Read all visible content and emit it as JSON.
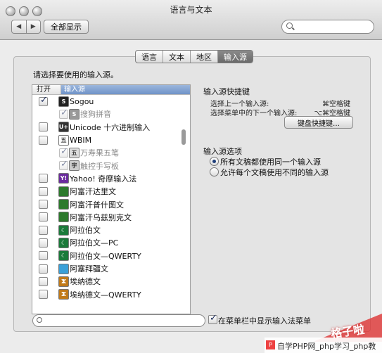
{
  "window": {
    "title": "语言与文本"
  },
  "toolbar": {
    "back": "◀",
    "forward": "▶",
    "show_all": "全部显示",
    "search_value": ""
  },
  "tabs": [
    {
      "label": "语言"
    },
    {
      "label": "文本"
    },
    {
      "label": "地区"
    },
    {
      "label": "输入源"
    }
  ],
  "active_tab": "输入源",
  "prompt": "请选择要使用的输入源。",
  "list": {
    "headers": {
      "enabled": "打开",
      "source": "输入源"
    },
    "items": [
      {
        "label": "Sogou",
        "checked": true,
        "icon": "sogou-icon",
        "icon_text": "S",
        "icon_color": "#222"
      },
      {
        "label": "搜狗拼音",
        "checked": true,
        "sub": true,
        "icon": "sogou-pinyin-icon",
        "icon_text": "S",
        "icon_color": "#999"
      },
      {
        "label": "Unicode 十六进制输入",
        "checked": false,
        "icon": "unicode-hex-icon",
        "icon_text": "U+",
        "icon_color": "#333"
      },
      {
        "label": "WBIM",
        "checked": false,
        "icon": "wubi-icon",
        "icon_text": "五",
        "icon_color": "#fff"
      },
      {
        "label": "万寿果五笔",
        "checked": true,
        "sub": true,
        "icon": "wubi-sub-icon",
        "icon_text": "五",
        "icon_color": "#ddd"
      },
      {
        "label": "触控手写板",
        "checked": true,
        "sub": true,
        "icon": "handwriting-icon",
        "icon_text": "字",
        "icon_color": "#ccc"
      },
      {
        "label": "Yahoo! 奇摩输入法",
        "checked": false,
        "icon": "yahoo-icon",
        "icon_text": "Y!",
        "icon_color": "#6b2b9e"
      },
      {
        "label": "阿富汗达里文",
        "checked": false,
        "icon": "afghan-dari-flag-icon",
        "icon_text": "",
        "icon_color": "#2c7a2c"
      },
      {
        "label": "阿富汗普什图文",
        "checked": false,
        "icon": "afghan-pashto-flag-icon",
        "icon_text": "",
        "icon_color": "#2c7a2c"
      },
      {
        "label": "阿富汗乌兹别克文",
        "checked": false,
        "icon": "afghan-uzbek-flag-icon",
        "icon_text": "",
        "icon_color": "#2c7a2c"
      },
      {
        "label": "阿拉伯文",
        "checked": false,
        "icon": "arabic-icon",
        "icon_text": "☾",
        "icon_color": "#1b7a3a"
      },
      {
        "label": "阿拉伯文—PC",
        "checked": false,
        "icon": "arabic-pc-icon",
        "icon_text": "☾",
        "icon_color": "#1b7a3a"
      },
      {
        "label": "阿拉伯文—QWERTY",
        "checked": false,
        "icon": "arabic-qwerty-icon",
        "icon_text": "☾",
        "icon_color": "#1b7a3a"
      },
      {
        "label": "阿塞拜疆文",
        "checked": false,
        "icon": "azerbaijan-flag-icon",
        "icon_text": "",
        "icon_color": "#3aa0d8"
      },
      {
        "label": "埃纳德文",
        "checked": false,
        "icon": "tamazight-icon",
        "icon_text": "ⵣ",
        "icon_color": "#c07a1a"
      },
      {
        "label": "埃纳德文—QWERTY",
        "checked": false,
        "icon": "tamazight-qwerty-icon",
        "icon_text": "ⵣ",
        "icon_color": "#c07a1a"
      }
    ]
  },
  "shortcuts": {
    "title": "输入源快捷键",
    "prev_label": "选择上一个输入源:",
    "prev_value": "⌘空格键",
    "next_label": "选择菜单中的下一个输入源:",
    "next_value": "⌥⌘空格键",
    "button": "键盘快捷键…"
  },
  "options": {
    "title": "输入源选项",
    "radio1": "所有文稿都使用同一个输入源",
    "radio2": "允许每个文稿使用不同的输入源",
    "selected": "radio1"
  },
  "filter_value": "",
  "show_menu_label": "在菜单栏中显示输入法菜单",
  "show_menu_checked": true,
  "watermark": {
    "top": "格子啦",
    "bottom": "自学PHP网_php学习_php教",
    "logo": "P"
  }
}
